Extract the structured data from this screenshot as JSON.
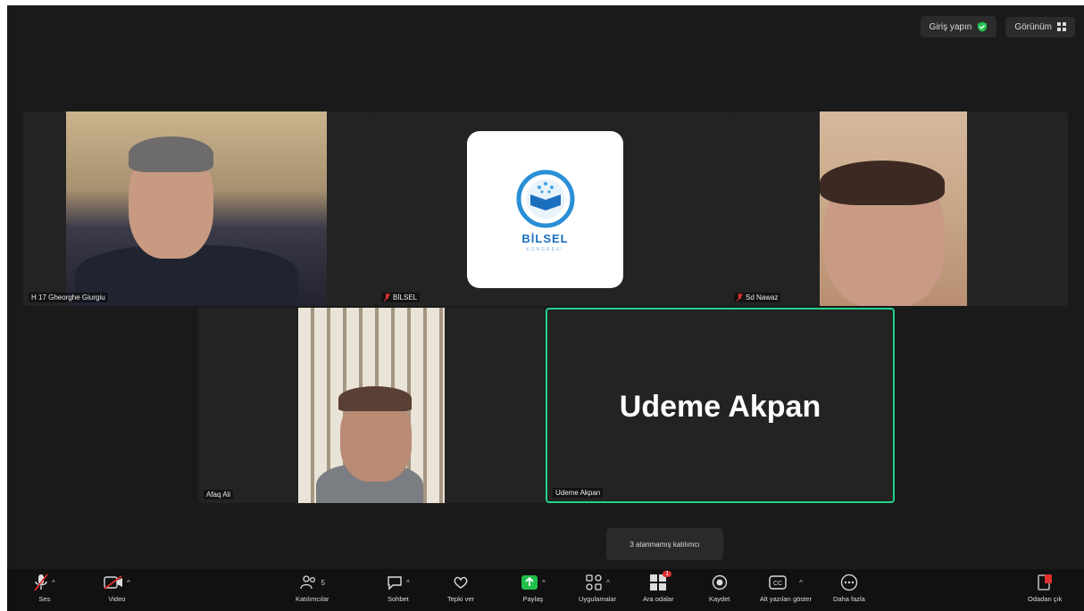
{
  "topbar": {
    "signin_label": "Giriş yapın",
    "view_label": "Görünüm"
  },
  "participants": [
    {
      "name": "H 17 Gheorghe Giurgiu",
      "muted": false
    },
    {
      "name": "BİLSEL",
      "muted": true,
      "logo_text": "BİLSEL",
      "logo_subtext": "KONGRESİ"
    },
    {
      "name": "Sd Nawaz",
      "muted": true
    },
    {
      "name": "Afaq Ali",
      "muted": false
    },
    {
      "name": "Udeme Akpan",
      "muted": false,
      "display_name": "Udeme Akpan"
    }
  ],
  "tooltip": "3 atanmamış katılımcı",
  "toolbar": {
    "audio": "Ses",
    "video": "Video",
    "participants": "Katılımcılar",
    "participants_count": "5",
    "chat": "Sohbet",
    "react": "Tepki ver",
    "share": "Paylaş",
    "apps": "Uygulamalar",
    "breakout": "Ara odalar",
    "breakout_badge": "1",
    "record": "Kaydet",
    "captions": "Alt yazıları göster",
    "more": "Daha fazla",
    "leave": "Odadan çık"
  },
  "colors": {
    "active_speaker": "#23d18b",
    "share_green": "#1fbf4a",
    "leave_red": "#e02f2f",
    "muted_red": "#e02f2f"
  }
}
